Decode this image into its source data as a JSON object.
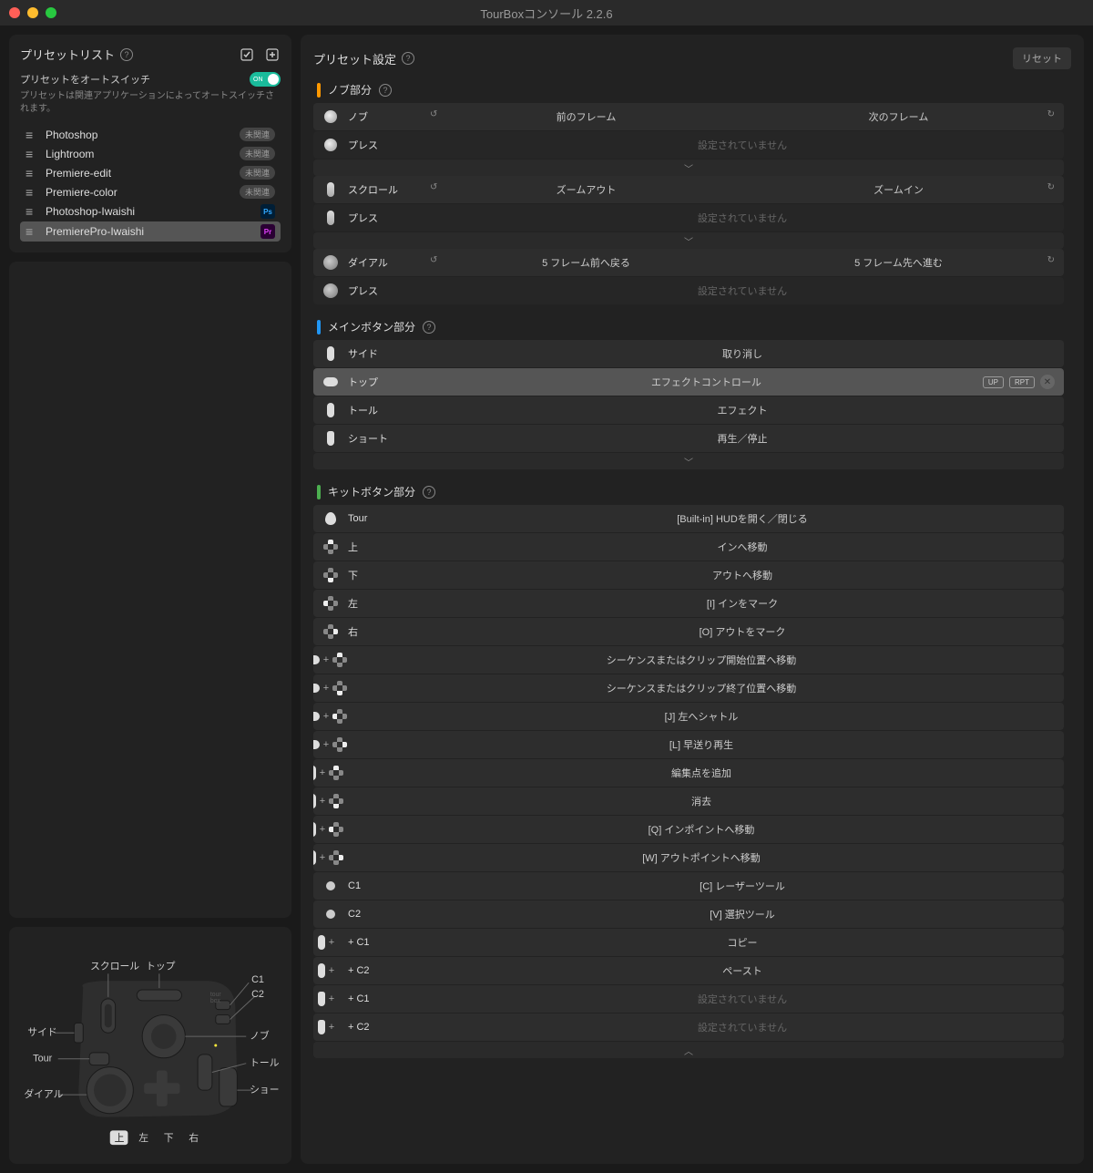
{
  "window": {
    "title": "TourBoxコンソール 2.2.6"
  },
  "sidebar": {
    "preset_list_title": "プリセットリスト",
    "auto_switch_label": "プリセットをオートスイッチ",
    "auto_switch_toggle": "ON",
    "auto_switch_desc": "プリセットは関連アプリケーションによってオートスイッチされます。",
    "unlinked_badge": "未関連",
    "presets": [
      {
        "name": "Photoshop",
        "badge": "unlinked"
      },
      {
        "name": "Lightroom",
        "badge": "unlinked"
      },
      {
        "name": "Premiere-edit",
        "badge": "unlinked"
      },
      {
        "name": "Premiere-color",
        "badge": "unlinked"
      },
      {
        "name": "Photoshop-Iwaishi",
        "badge": "Ps",
        "app": "ps"
      },
      {
        "name": "PremierePro-Iwaishi",
        "badge": "Pr",
        "app": "pr",
        "selected": true
      }
    ]
  },
  "settings": {
    "title": "プリセット設定",
    "reset": "リセット",
    "sections": {
      "knob": {
        "title": "ノブ部分",
        "rows": [
          {
            "label": "ノブ",
            "left": "前のフレーム",
            "right": "次のフレーム",
            "rotate": true
          },
          {
            "label": "プレス",
            "center": "設定されていません",
            "unset": true
          }
        ]
      },
      "scroll": {
        "rows": [
          {
            "label": "スクロール",
            "left": "ズームアウト",
            "right": "ズームイン",
            "rotate": true
          },
          {
            "label": "プレス",
            "center": "設定されていません",
            "unset": true
          }
        ]
      },
      "dial": {
        "rows": [
          {
            "label": "ダイアル",
            "left": "5 フレーム前へ戻る",
            "right": "5 フレーム先へ進む",
            "rotate": true
          },
          {
            "label": "プレス",
            "center": "設定されていません",
            "unset": true
          }
        ]
      },
      "main": {
        "title": "メインボタン部分",
        "rows": [
          {
            "label": "サイド",
            "center": "取り消し"
          },
          {
            "label": "トップ",
            "center": "エフェクトコントロール",
            "highlighted": true,
            "badges": [
              "UP",
              "RPT"
            ],
            "clear": true
          },
          {
            "label": "トール",
            "center": "エフェクト"
          },
          {
            "label": "ショート",
            "center": "再生／停止"
          }
        ]
      },
      "kit": {
        "title": "キットボタン部分",
        "rows": [
          {
            "label": "Tour",
            "center": "[Built-in] HUDを開く／閉じる"
          },
          {
            "label": "上",
            "center": "インへ移動"
          },
          {
            "label": "下",
            "center": "アウトへ移動"
          },
          {
            "label": "左",
            "center": "[I]  インをマーク"
          },
          {
            "label": "右",
            "center": "[O] アウトをマーク"
          },
          {
            "combo": "top+up",
            "center": "シーケンスまたはクリップ開始位置へ移動"
          },
          {
            "combo": "top+down",
            "center": "シーケンスまたはクリップ終了位置へ移動"
          },
          {
            "combo": "top+left",
            "center": "[J] 左へシャトル"
          },
          {
            "combo": "top+right",
            "center": "[L]  早送り再生"
          },
          {
            "combo": "tall+up",
            "center": "編集点を追加"
          },
          {
            "combo": "tall+down",
            "center": "消去"
          },
          {
            "combo": "tall+left",
            "center": "[Q] インポイントへ移動"
          },
          {
            "combo": "tall+right",
            "center": "[W] アウトポイントへ移動"
          },
          {
            "label": "C1",
            "center": "[C] レーザーツール"
          },
          {
            "label": "C2",
            "center": "[V] 選択ツール"
          },
          {
            "combo": "tall+C1",
            "label": "+ C1",
            "center": "コピー"
          },
          {
            "combo": "tall+C2",
            "label": "+ C2",
            "center": "ペースト"
          },
          {
            "combo": "short+C1",
            "label": "+ C1",
            "center": "設定されていません",
            "unset": true
          },
          {
            "combo": "short+C2",
            "label": "+ C2",
            "center": "設定されていません",
            "unset": true
          }
        ]
      }
    }
  },
  "diagram": {
    "labels": {
      "scroll": "スクロール",
      "top": "トップ",
      "c1": "C1",
      "c2": "C2",
      "side": "サイド",
      "tour": "Tour",
      "dial": "ダイアル",
      "knob": "ノブ",
      "tall": "トール",
      "short": "ショート",
      "up": "上",
      "left": "左",
      "down": "下",
      "right": "右"
    }
  }
}
